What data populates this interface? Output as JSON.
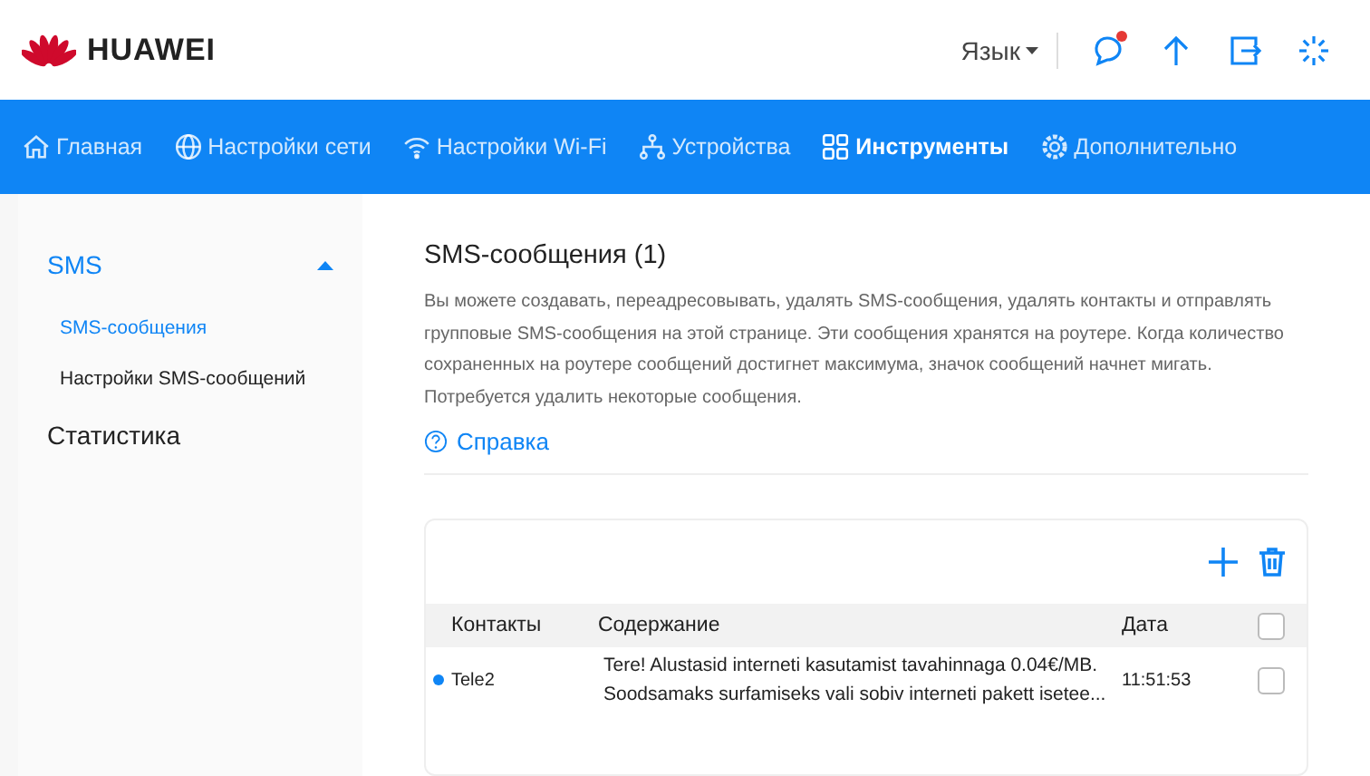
{
  "header": {
    "brand": "HUAWEI",
    "language": "Язык",
    "has_new_message": true
  },
  "nav": [
    {
      "label": "Главная",
      "selected": false
    },
    {
      "label": "Настройки сети",
      "selected": false
    },
    {
      "label": "Настройки Wi-Fi",
      "selected": false
    },
    {
      "label": "Устройства",
      "selected": false
    },
    {
      "label": "Инструменты",
      "selected": true
    },
    {
      "label": "Дополнительно",
      "selected": false
    }
  ],
  "sidebar": [
    {
      "label": "SMS",
      "expanded": true,
      "selected": true,
      "children": [
        {
          "label": "SMS-сообщения",
          "selected": true
        },
        {
          "label": "Настройки SMS-сообщений",
          "selected": false
        }
      ]
    },
    {
      "label": "Статистика",
      "selected": false
    }
  ],
  "content": {
    "title": "SMS-сообщения (1)",
    "description": "Вы можете создавать, переадресовывать, удалять SMS-сообщения, удалять контакты и отправлять групповые SMS-сообщения на этой странице. Эти сообщения хранятся на роутере. Когда количество сохраненных на роутере сообщений достигнет максимума, значок сообщений начнет мигать. Потребуется удалить некоторые сообщения.",
    "help": "Справка"
  },
  "table": {
    "columns": [
      "Контакты",
      "Содержание",
      "Дата"
    ],
    "all_checked": false,
    "rows": [
      {
        "contact": "Tele2",
        "unread": true,
        "content": "Tere! Alustasid interneti kasutamist tavahinnaga 0.04€/MB. Soodsamaks surfamiseks vali sobiv interneti pakett isetee...",
        "date": "11:51:53",
        "checked": false
      }
    ]
  }
}
